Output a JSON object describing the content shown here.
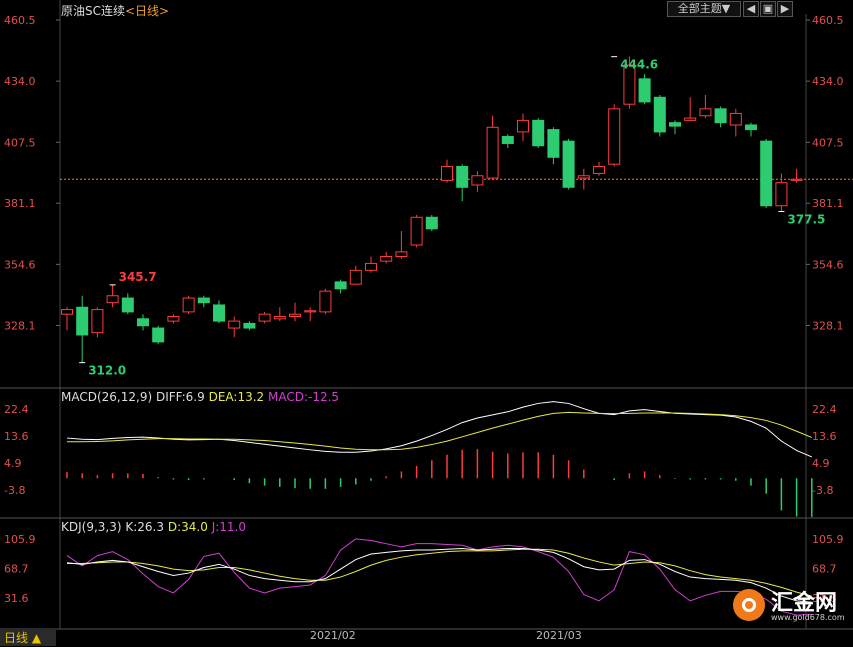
{
  "title": {
    "instrument": "原油SC连续",
    "period": "<日线>"
  },
  "top_controls": {
    "theme_label": "全部主题▼",
    "buttons": [
      "◀",
      "▣",
      "▶"
    ]
  },
  "main_axis": {
    "ticks": [
      "460.5",
      "434.0",
      "407.5",
      "381.1",
      "354.6",
      "328.1"
    ],
    "range": [
      302.0,
      460.5
    ],
    "current_price_line": 391.5
  },
  "macd_panel": {
    "label": "MACD(26,12,9)",
    "diff_label": "DIFF:6.9",
    "dea_label": "DEA:13.2",
    "macd_label": "MACD:-12.5",
    "ticks": [
      "22.4",
      "13.6",
      "4.9",
      "-3.8"
    ]
  },
  "kdj_panel": {
    "label": "KDJ(9,3,3)",
    "k_label": "K:26.3",
    "d_label": "D:34.0",
    "j_label": "J:11.0",
    "ticks": [
      "105.9",
      "68.7",
      "31.6"
    ]
  },
  "x_axis": {
    "labels": [
      "2021/02",
      "2021/03"
    ]
  },
  "bottom_bar": {
    "tab_label": "日线 ▲"
  },
  "logo": {
    "brand": "汇金网",
    "url_text": "www.gold678.com"
  },
  "colors": {
    "up": "#ff3b3b",
    "down": "#2ecc71",
    "diff_line": "#ffffff",
    "dea_line": "#e8e84a",
    "k_line": "#ffffff",
    "d_line": "#e8e84a",
    "j_line": "#d040d0",
    "price_line": "#e08a20",
    "axis_text_red": "#e05050"
  },
  "chart_data": [
    {
      "type": "candlestick",
      "title": "原油SC连续 <日线>",
      "ylim": [
        302.0,
        460.5
      ],
      "annotations": [
        {
          "label": "345.7",
          "value": 345.7,
          "candle_index": 3
        },
        {
          "label": "312.0",
          "value": 312.0,
          "candle_index": 1
        },
        {
          "label": "444.6",
          "value": 444.6,
          "candle_index": 36
        },
        {
          "label": "377.5",
          "value": 377.5,
          "candle_index": 47
        }
      ],
      "candles": [
        {
          "o": 333.0,
          "h": 336.0,
          "l": 326.0,
          "c": 335.0
        },
        {
          "o": 336.0,
          "h": 341.0,
          "l": 312.0,
          "c": 324.0
        },
        {
          "o": 325.0,
          "h": 336.0,
          "l": 323.0,
          "c": 335.0
        },
        {
          "o": 338.0,
          "h": 345.7,
          "l": 336.0,
          "c": 341.0
        },
        {
          "o": 340.0,
          "h": 342.0,
          "l": 333.0,
          "c": 334.0
        },
        {
          "o": 331.0,
          "h": 333.0,
          "l": 326.0,
          "c": 328.0
        },
        {
          "o": 327.0,
          "h": 328.0,
          "l": 320.0,
          "c": 321.0
        },
        {
          "o": 330.0,
          "h": 333.0,
          "l": 329.0,
          "c": 332.0
        },
        {
          "o": 334.0,
          "h": 341.0,
          "l": 333.0,
          "c": 340.0
        },
        {
          "o": 340.0,
          "h": 341.0,
          "l": 336.0,
          "c": 338.0
        },
        {
          "o": 337.0,
          "h": 339.0,
          "l": 329.0,
          "c": 330.0
        },
        {
          "o": 327.0,
          "h": 332.0,
          "l": 323.0,
          "c": 330.0
        },
        {
          "o": 329.0,
          "h": 330.0,
          "l": 326.0,
          "c": 327.0
        },
        {
          "o": 330.0,
          "h": 334.0,
          "l": 329.0,
          "c": 333.0
        },
        {
          "o": 331.0,
          "h": 336.0,
          "l": 330.0,
          "c": 332.0
        },
        {
          "o": 332.0,
          "h": 338.0,
          "l": 330.0,
          "c": 333.0
        },
        {
          "o": 334.0,
          "h": 336.0,
          "l": 330.0,
          "c": 334.5
        },
        {
          "o": 334.0,
          "h": 344.0,
          "l": 333.0,
          "c": 343.0
        },
        {
          "o": 347.0,
          "h": 348.0,
          "l": 342.0,
          "c": 344.0
        },
        {
          "o": 346.0,
          "h": 354.0,
          "l": 346.0,
          "c": 352.0
        },
        {
          "o": 352.0,
          "h": 358.0,
          "l": 351.0,
          "c": 355.0
        },
        {
          "o": 356.0,
          "h": 360.0,
          "l": 355.0,
          "c": 358.0
        },
        {
          "o": 358.0,
          "h": 369.0,
          "l": 357.0,
          "c": 360.0
        },
        {
          "o": 363.0,
          "h": 376.0,
          "l": 362.0,
          "c": 375.0
        },
        {
          "o": 375.0,
          "h": 376.0,
          "l": 369.0,
          "c": 370.0
        },
        {
          "o": 391.0,
          "h": 400.0,
          "l": 390.0,
          "c": 397.0
        },
        {
          "o": 397.0,
          "h": 398.0,
          "l": 382.0,
          "c": 388.0
        },
        {
          "o": 389.0,
          "h": 395.0,
          "l": 386.0,
          "c": 393.0
        },
        {
          "o": 392.0,
          "h": 419.0,
          "l": 391.0,
          "c": 414.0
        },
        {
          "o": 410.0,
          "h": 411.0,
          "l": 405.0,
          "c": 407.0
        },
        {
          "o": 412.0,
          "h": 420.0,
          "l": 408.0,
          "c": 417.0
        },
        {
          "o": 417.0,
          "h": 418.0,
          "l": 405.0,
          "c": 406.0
        },
        {
          "o": 413.0,
          "h": 414.0,
          "l": 398.0,
          "c": 401.0
        },
        {
          "o": 408.0,
          "h": 409.0,
          "l": 387.0,
          "c": 388.0
        },
        {
          "o": 392.0,
          "h": 396.0,
          "l": 387.0,
          "c": 393.0
        },
        {
          "o": 394.0,
          "h": 399.0,
          "l": 393.0,
          "c": 397.0
        },
        {
          "o": 398.0,
          "h": 424.0,
          "l": 397.0,
          "c": 422.0
        },
        {
          "o": 424.0,
          "h": 444.6,
          "l": 422.0,
          "c": 441.0
        },
        {
          "o": 435.0,
          "h": 437.0,
          "l": 424.0,
          "c": 425.0
        },
        {
          "o": 427.0,
          "h": 428.0,
          "l": 410.0,
          "c": 412.0
        },
        {
          "o": 416.0,
          "h": 417.0,
          "l": 411.0,
          "c": 414.5
        },
        {
          "o": 417.0,
          "h": 427.0,
          "l": 417.0,
          "c": 418.0
        },
        {
          "o": 419.0,
          "h": 428.0,
          "l": 418.0,
          "c": 422.0
        },
        {
          "o": 422.0,
          "h": 423.0,
          "l": 414.0,
          "c": 416.0
        },
        {
          "o": 415.0,
          "h": 422.0,
          "l": 410.0,
          "c": 420.0
        },
        {
          "o": 415.0,
          "h": 416.0,
          "l": 410.0,
          "c": 413.0
        },
        {
          "o": 408.0,
          "h": 409.0,
          "l": 379.0,
          "c": 380.0
        },
        {
          "o": 380.0,
          "h": 394.0,
          "l": 377.5,
          "c": 390.0
        },
        {
          "o": 391.0,
          "h": 396.0,
          "l": 390.0,
          "c": 391.5
        }
      ]
    },
    {
      "type": "line",
      "title": "MACD(26,12,9)",
      "ylim": [
        -12.5,
        26.0
      ],
      "series": [
        {
          "name": "DIFF",
          "values": [
            13.0,
            12.6,
            12.5,
            12.9,
            13.2,
            13.3,
            13.0,
            12.6,
            12.4,
            12.5,
            12.6,
            12.2,
            11.6,
            11.0,
            10.4,
            9.8,
            9.2,
            8.7,
            8.4,
            8.4,
            8.8,
            9.5,
            10.5,
            12.0,
            13.8,
            15.8,
            18.0,
            19.5,
            20.5,
            21.5,
            23.0,
            24.2,
            24.8,
            24.2,
            22.5,
            21.0,
            20.6,
            21.8,
            22.2,
            21.6,
            21.0,
            20.8,
            20.6,
            20.4,
            19.8,
            18.4,
            16.2,
            12.0,
            9.0,
            6.9
          ]
        },
        {
          "name": "DEA",
          "values": [
            11.8,
            11.8,
            11.9,
            12.1,
            12.4,
            12.6,
            12.8,
            12.8,
            12.7,
            12.7,
            12.6,
            12.6,
            12.4,
            12.2,
            11.8,
            11.4,
            10.9,
            10.4,
            9.8,
            9.4,
            9.2,
            9.2,
            9.4,
            10.0,
            10.9,
            12.0,
            13.4,
            14.8,
            16.2,
            17.5,
            18.8,
            20.0,
            21.0,
            21.3,
            21.1,
            21.0,
            20.9,
            21.0,
            21.1,
            21.1,
            21.1,
            21.0,
            20.8,
            20.6,
            20.2,
            19.6,
            18.7,
            17.2,
            15.2,
            13.2
          ]
        },
        {
          "name": "MACD",
          "values": [
            2.0,
            1.6,
            1.0,
            1.6,
            1.6,
            1.4,
            0.4,
            -0.4,
            -0.6,
            -0.4,
            0.0,
            -0.6,
            -1.6,
            -2.4,
            -2.8,
            -3.2,
            -3.4,
            -3.4,
            -2.8,
            -2.0,
            -0.8,
            0.6,
            2.2,
            4.0,
            5.8,
            7.6,
            9.2,
            9.4,
            8.6,
            8.0,
            8.4,
            8.4,
            7.6,
            5.8,
            2.8,
            0.0,
            -0.6,
            1.6,
            2.2,
            1.0,
            -0.2,
            -0.4,
            -0.4,
            -0.4,
            -0.8,
            -2.4,
            -5.0,
            -10.4,
            -12.4,
            -12.5
          ]
        }
      ]
    },
    {
      "type": "line",
      "title": "KDJ(9,3,3)",
      "ylim": [
        5.0,
        110.0
      ],
      "series": [
        {
          "name": "K",
          "values": [
            76,
            74,
            77,
            79,
            77,
            71,
            65,
            60,
            63,
            70,
            74,
            68,
            60,
            56,
            54,
            52,
            52,
            56,
            68,
            80,
            87,
            89,
            91,
            92,
            92,
            93,
            94,
            92,
            93,
            94,
            94,
            92,
            89,
            81,
            71,
            67,
            68,
            79,
            80,
            74,
            65,
            58,
            56,
            55,
            54,
            51,
            44,
            34,
            28,
            26.3
          ]
        },
        {
          "name": "D",
          "values": [
            75,
            75,
            76,
            77,
            77,
            75,
            72,
            68,
            66,
            67,
            70,
            70,
            67,
            63,
            59,
            56,
            54,
            54,
            58,
            65,
            73,
            79,
            83,
            86,
            88,
            90,
            91,
            91,
            91,
            92,
            93,
            93,
            92,
            88,
            82,
            77,
            73,
            75,
            77,
            76,
            72,
            66,
            61,
            58,
            56,
            54,
            50,
            45,
            39,
            34.0
          ]
        },
        {
          "name": "J",
          "values": [
            85,
            72,
            85,
            90,
            80,
            62,
            46,
            38,
            55,
            84,
            88,
            64,
            44,
            38,
            44,
            46,
            48,
            60,
            92,
            106,
            104,
            100,
            96,
            100,
            100,
            99,
            98,
            92,
            96,
            98,
            96,
            90,
            83,
            65,
            36,
            28,
            42,
            90,
            86,
            68,
            42,
            28,
            35,
            40,
            40,
            38,
            30,
            15,
            10,
            11.0
          ]
        }
      ]
    }
  ]
}
